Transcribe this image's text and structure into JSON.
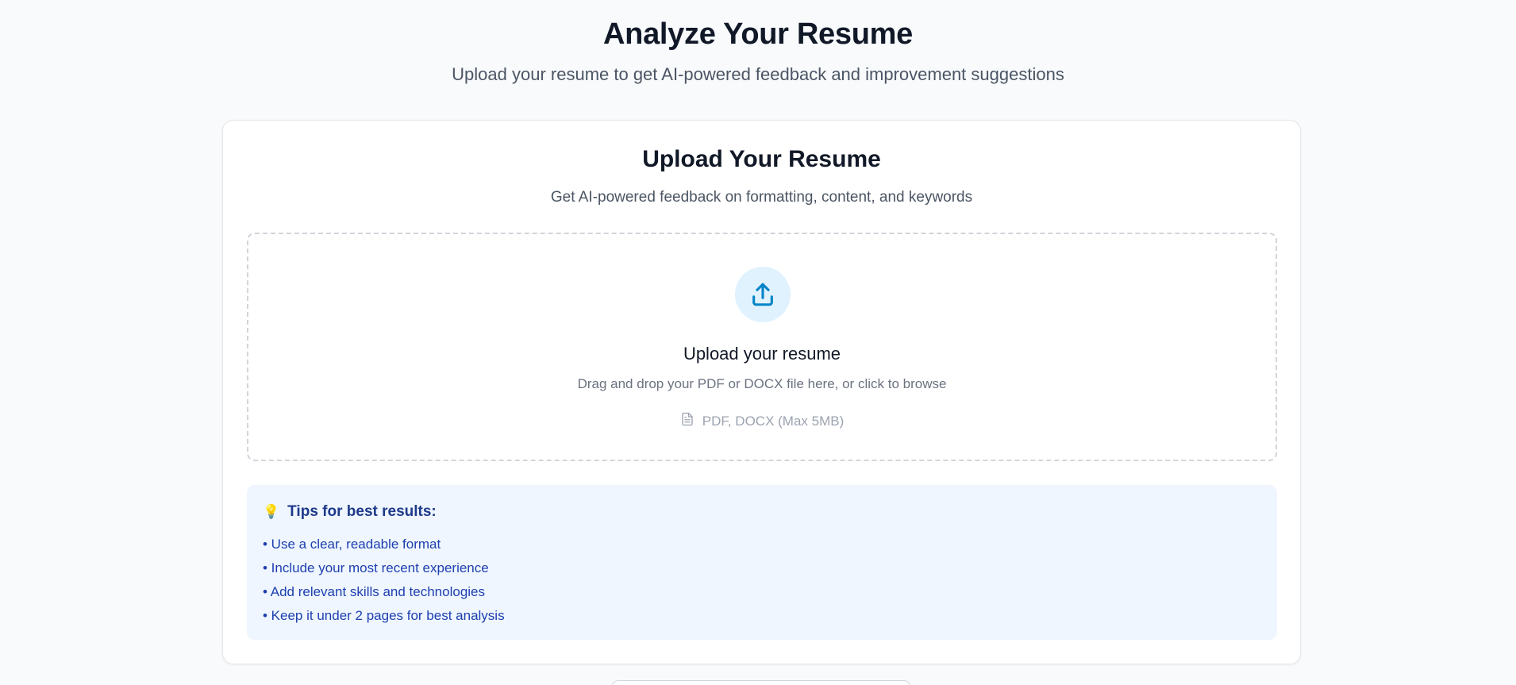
{
  "header": {
    "title": "Analyze Your Resume",
    "subtitle": "Upload your resume to get AI-powered feedback and improvement suggestions"
  },
  "card": {
    "title": "Upload Your Resume",
    "subtitle": "Get AI-powered feedback on formatting, content, and keywords"
  },
  "dropzone": {
    "icon": "upload-icon",
    "title": "Upload your resume",
    "description": "Drag and drop your PDF or DOCX file here, or click to browse",
    "formats_icon": "document-icon",
    "formats": "PDF, DOCX (Max 5MB)"
  },
  "tips": {
    "icon": "lightbulb-icon",
    "heading": "Tips for best results:",
    "items": [
      "• Use a clear, readable format",
      "• Include your most recent experience",
      "• Add relevant skills and technologies",
      "• Keep it under 2 pages for best analysis"
    ]
  },
  "colors": {
    "accent": "#0284c7",
    "accent_bg": "#e0f2fe",
    "tips_bg": "#eff6ff",
    "tips_text": "#1e40af"
  }
}
